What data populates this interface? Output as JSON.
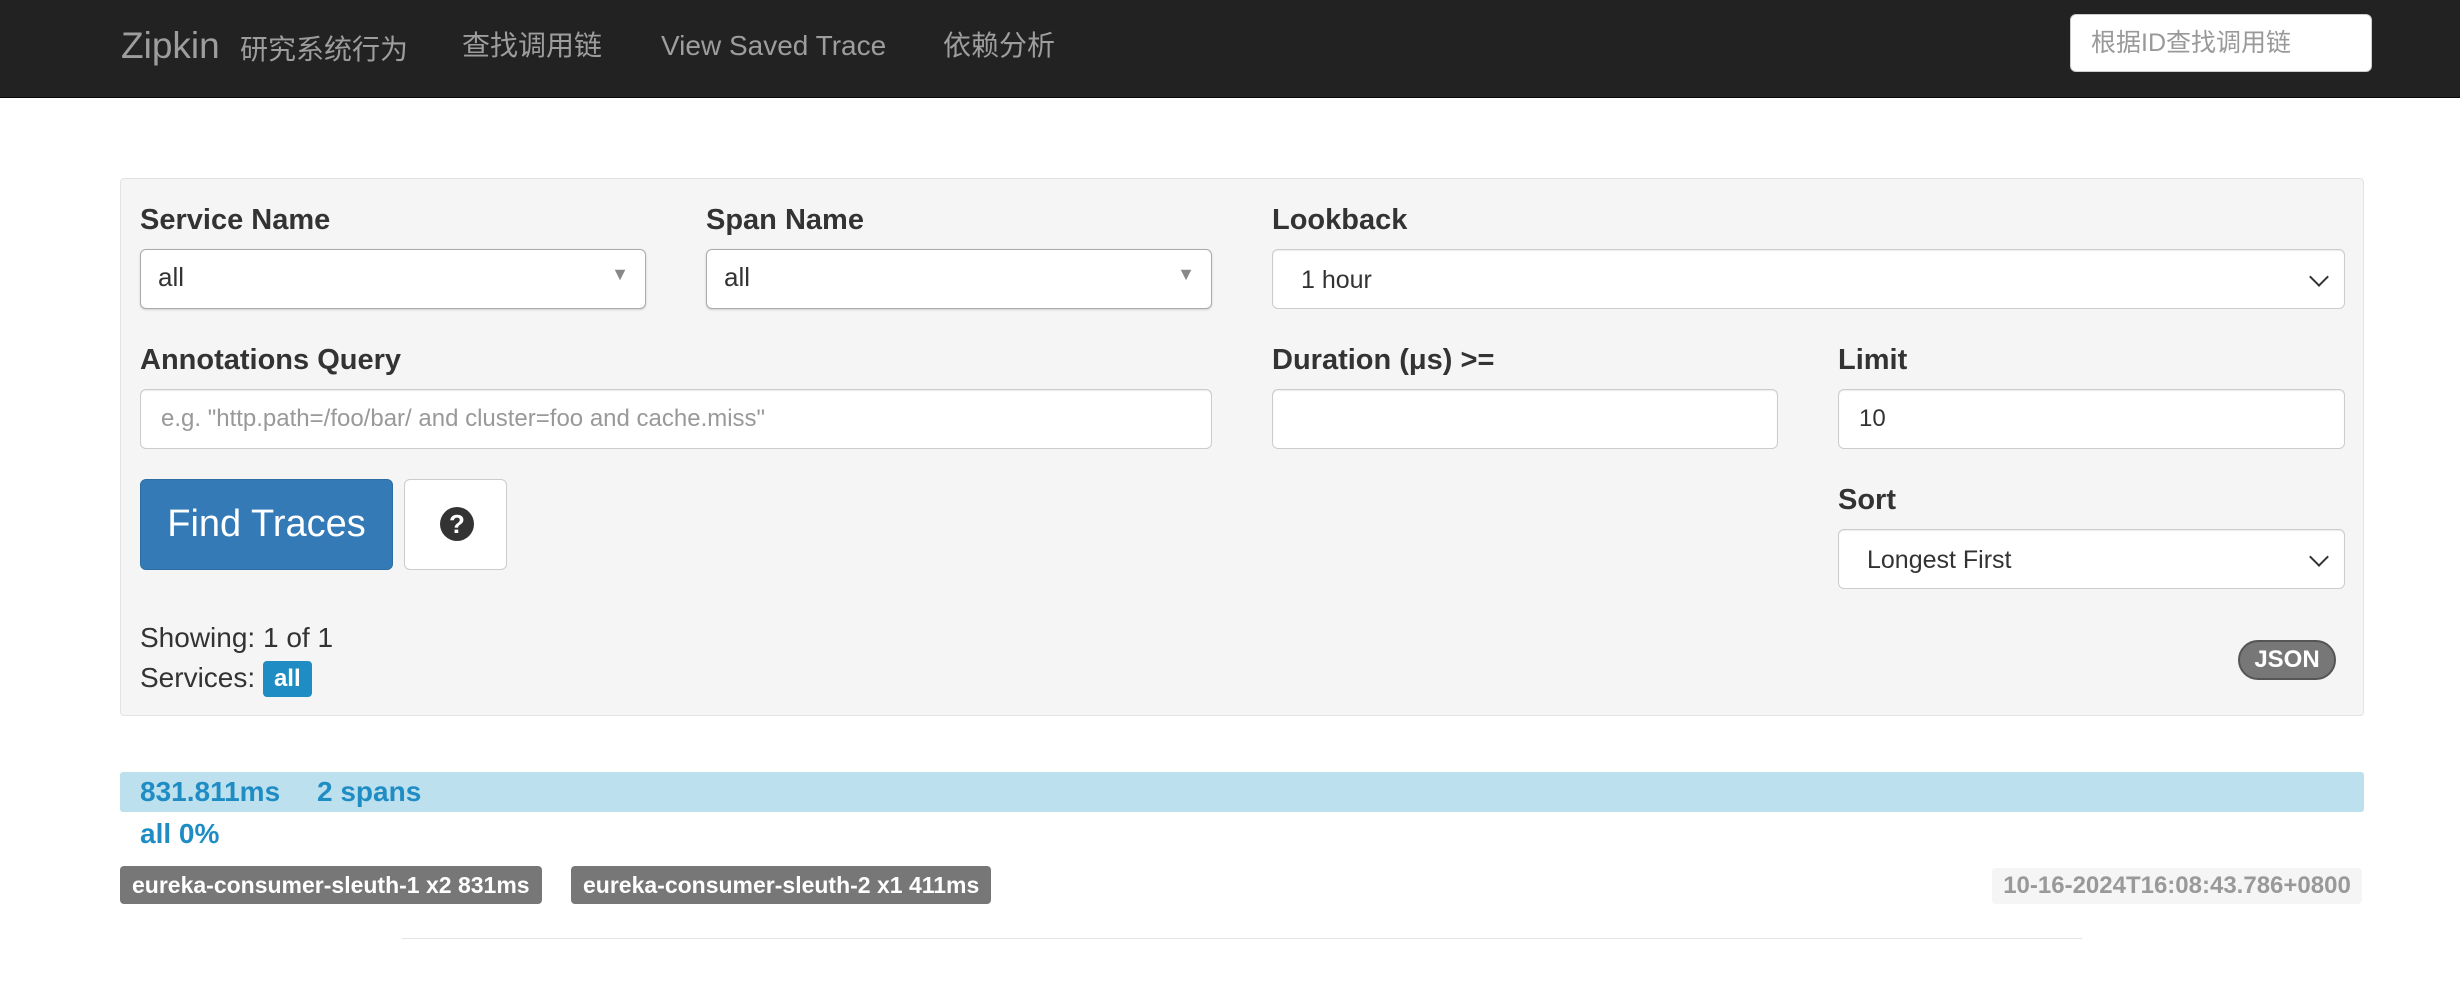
{
  "navbar": {
    "brand": "Zipkin",
    "subtitle": "研究系统行为",
    "links": [
      "查找调用链",
      "View Saved Trace",
      "依赖分析"
    ],
    "search_placeholder": "根据ID查找调用链"
  },
  "search": {
    "service_name": {
      "label": "Service Name",
      "value": "all"
    },
    "span_name": {
      "label": "Span Name",
      "value": "all"
    },
    "lookback": {
      "label": "Lookback",
      "value": "1 hour"
    },
    "annotations": {
      "label": "Annotations Query",
      "placeholder": "e.g. \"http.path=/foo/bar/ and cluster=foo and cache.miss\""
    },
    "duration": {
      "label": "Duration (μs) >=",
      "value": ""
    },
    "limit": {
      "label": "Limit",
      "value": "10"
    },
    "sort": {
      "label": "Sort",
      "value": "Longest First"
    },
    "find_button": "Find Traces",
    "help_icon": "?",
    "showing": "Showing: 1 of 1",
    "services_label": "Services:",
    "services_badge": "all",
    "json_button": "JSON"
  },
  "traces": [
    {
      "duration": "831.811ms",
      "spans": "2 spans",
      "service_pct": "all 0%",
      "services": [
        "eureka-consumer-sleuth-1 x2 831ms",
        "eureka-consumer-sleuth-2 x1 411ms"
      ],
      "timestamp": "10-16-2024T16:08:43.786+0800"
    }
  ],
  "colors": {
    "navbar_bg": "#222222",
    "primary": "#337ab7",
    "info": "#1f8dc4",
    "trace_bar": "#bde0ef"
  }
}
